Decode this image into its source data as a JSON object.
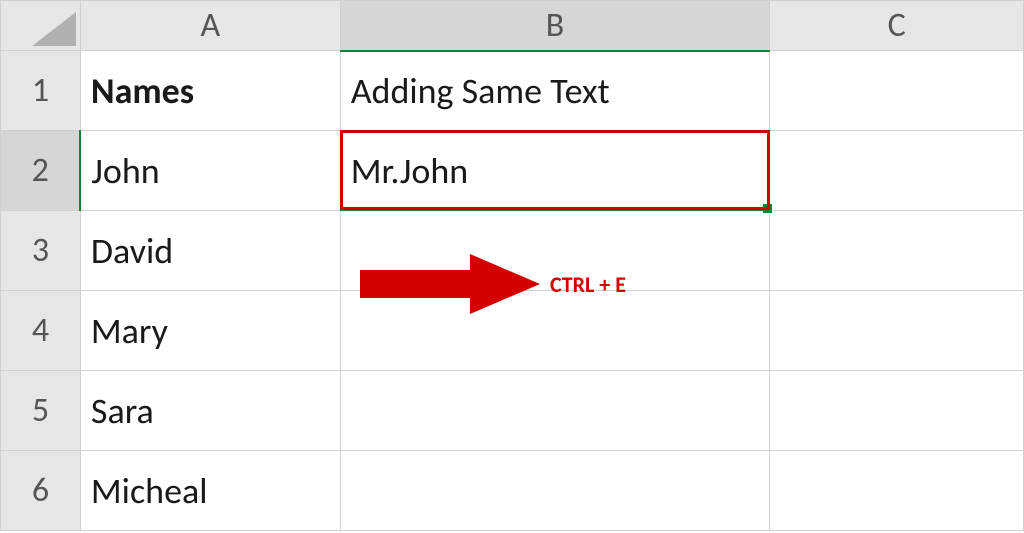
{
  "columns": {
    "A": "A",
    "B": "B",
    "C": "C"
  },
  "rowNumbers": [
    "1",
    "2",
    "3",
    "4",
    "5",
    "6"
  ],
  "selectedColumn": "B",
  "selectedRow": "2",
  "headers": {
    "A": "Names",
    "B": "Adding Same Text"
  },
  "data": {
    "A": [
      "John",
      "David",
      "Mary",
      "Sara",
      "Micheal"
    ],
    "B": [
      "Mr.John",
      "",
      "",
      "",
      ""
    ]
  },
  "activeCell": {
    "row": 2,
    "col": "B",
    "value": "Mr.John"
  },
  "annotation": {
    "shortcut": "CTRL + E",
    "highlightCell": "B2"
  },
  "colors": {
    "accent": "#1a7f37",
    "annotation": "#d40000"
  }
}
